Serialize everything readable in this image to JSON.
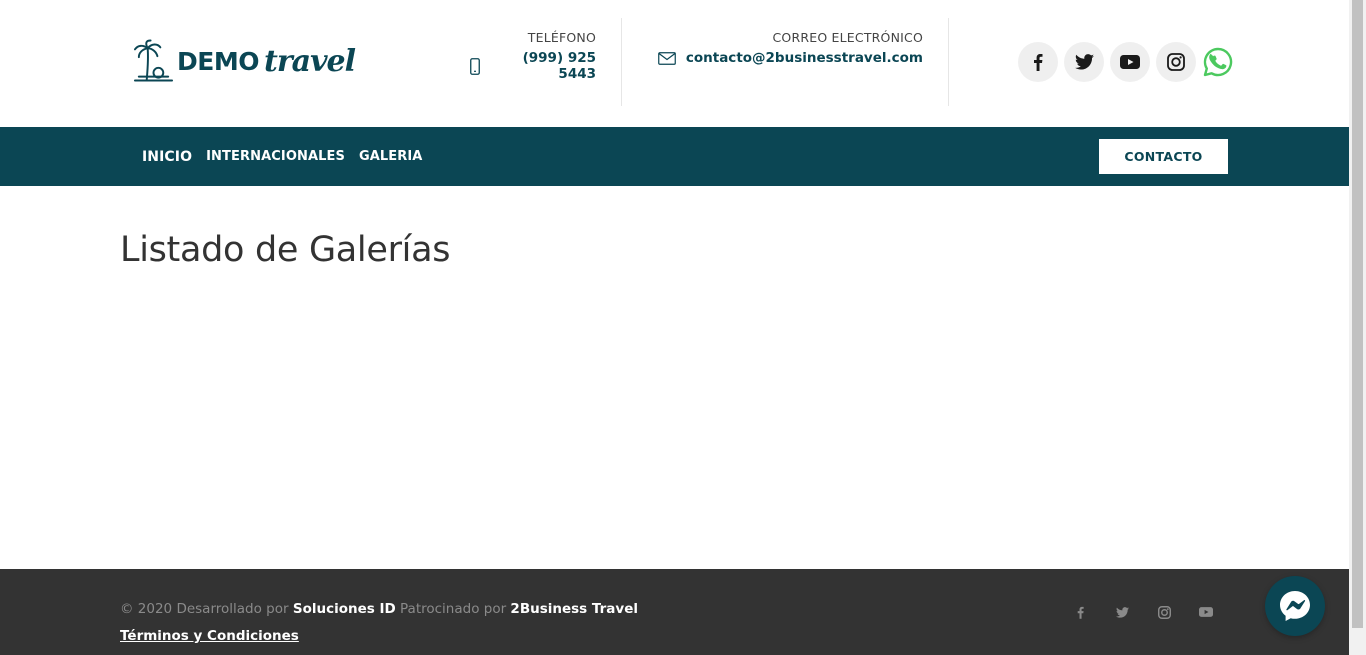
{
  "brand": {
    "logo_demo": "DEMO",
    "logo_travel": "travel",
    "primary_color": "#0b4654"
  },
  "header": {
    "phone_label": "TELÉFONO",
    "phone_value": "(999) 925 5443",
    "email_label": "CORREO ELECTRÓNICO",
    "email_value": "contacto@2businesstravel.com",
    "socials": [
      "facebook-icon",
      "twitter-icon",
      "youtube-icon",
      "instagram-icon",
      "whatsapp-icon"
    ]
  },
  "nav": {
    "items": [
      {
        "label": "INICIO"
      },
      {
        "label": "INTERNACIONALES"
      },
      {
        "label": "GALERIA"
      }
    ],
    "contact_button": "CONTACTO"
  },
  "main": {
    "title": "Listado de Galerías"
  },
  "footer": {
    "copyright_prefix": "© 2020 Desarrollado por ",
    "developer": "Soluciones ID",
    "sponsor_prefix": " Patrocinado por ",
    "sponsor": "2Business Travel",
    "terms": "Términos y Condiciones",
    "socials": [
      "facebook-icon",
      "twitter-icon",
      "instagram-icon",
      "youtube-icon"
    ],
    "background_color": "#333333"
  }
}
